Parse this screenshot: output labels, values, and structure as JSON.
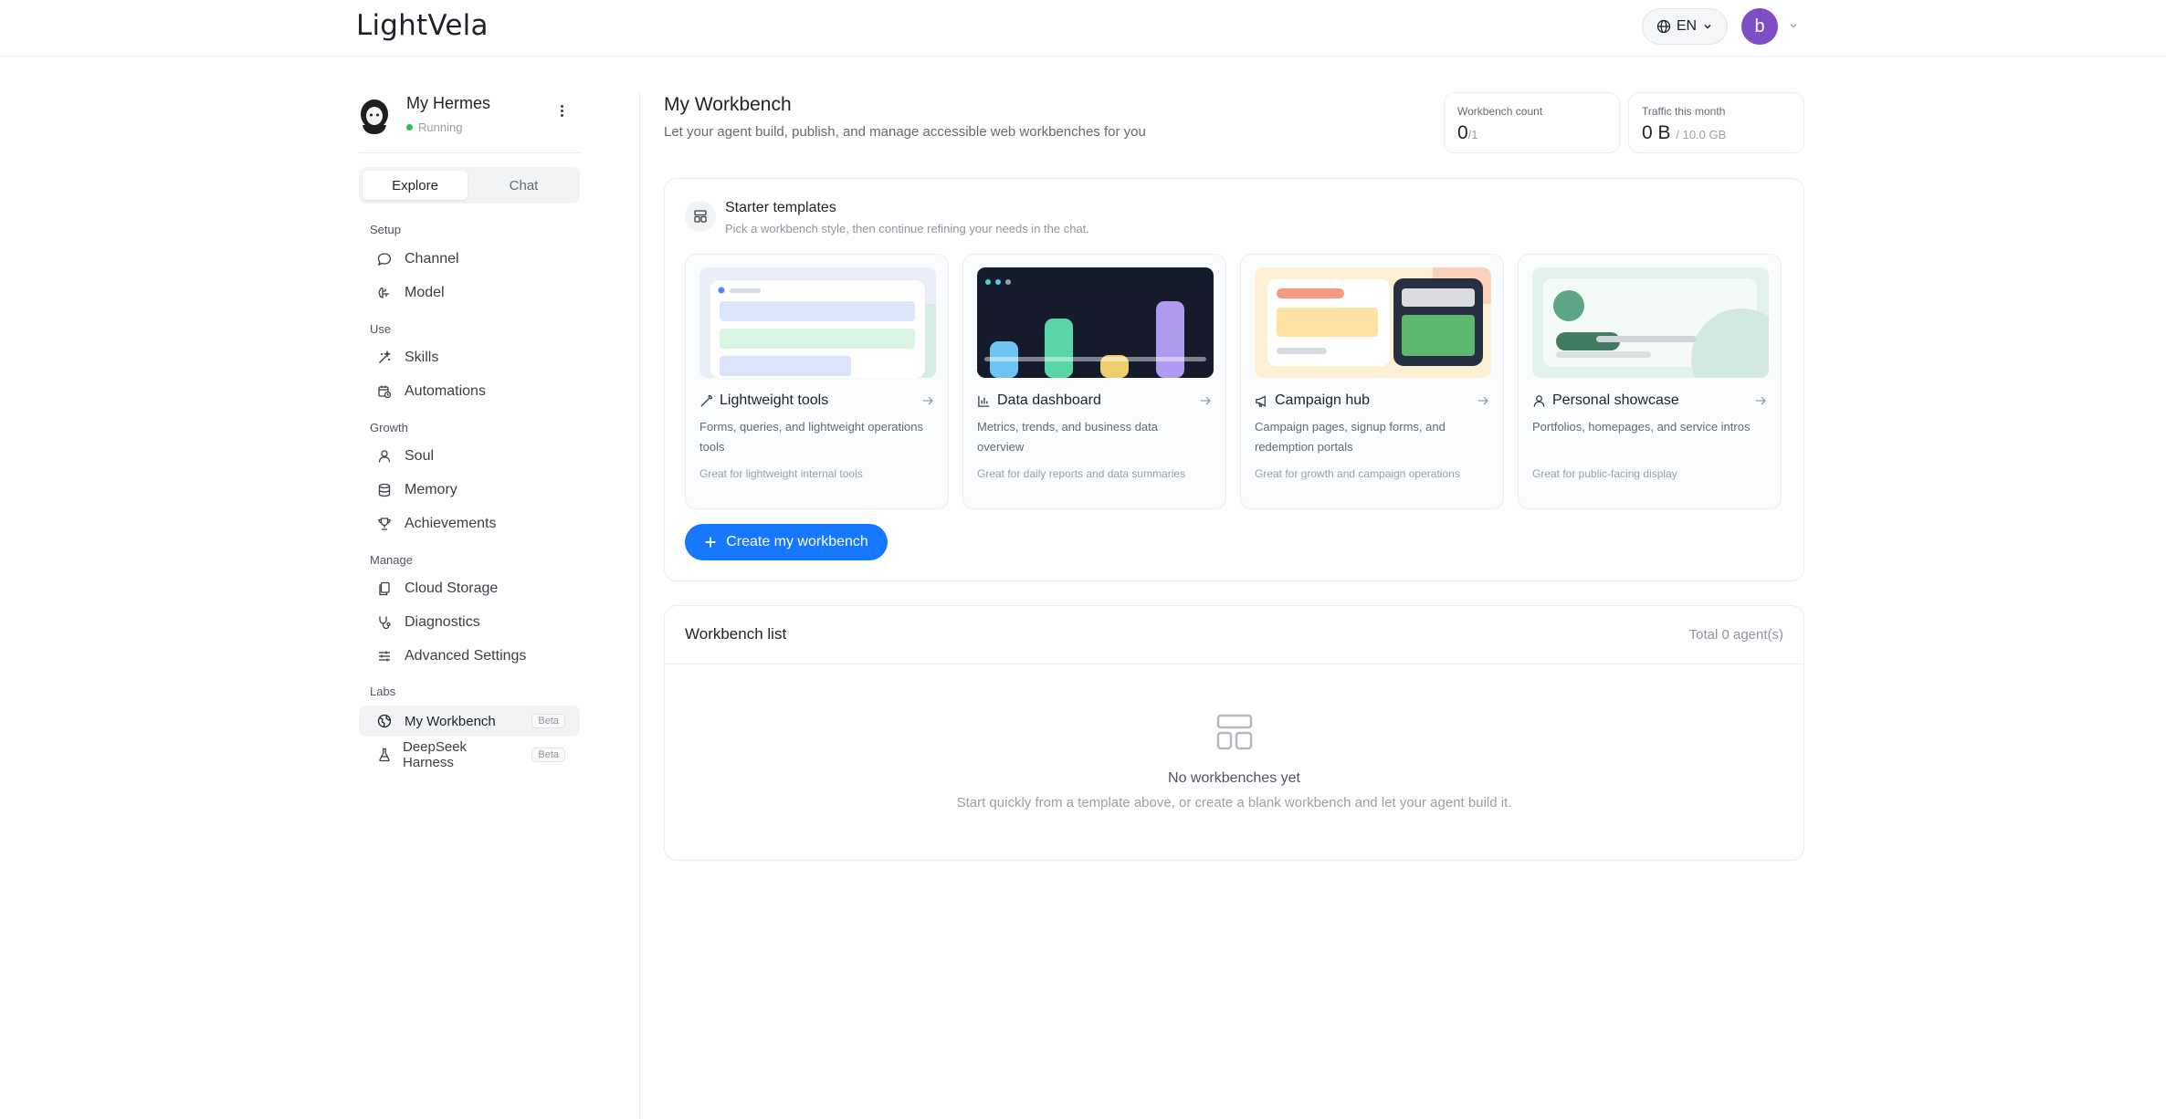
{
  "app": {
    "logo": "LightVela"
  },
  "header": {
    "language": "EN",
    "user_initial": "b"
  },
  "agent": {
    "name": "My Hermes",
    "status": "Running"
  },
  "tabs": [
    {
      "label": "Explore",
      "active": true
    },
    {
      "label": "Chat",
      "active": false
    }
  ],
  "sidebar": {
    "setup": {
      "label": "Setup",
      "items": [
        "Channel",
        "Model"
      ]
    },
    "use": {
      "label": "Use",
      "items": [
        "Skills",
        "Automations"
      ]
    },
    "growth": {
      "label": "Growth",
      "items": [
        "Soul",
        "Memory",
        "Achievements"
      ]
    },
    "manage": {
      "label": "Manage",
      "items": [
        "Cloud Storage",
        "Diagnostics",
        "Advanced Settings"
      ]
    },
    "labs": {
      "label": "Labs",
      "items": [
        {
          "label": "My Workbench",
          "badge": "Beta",
          "active": true
        },
        {
          "label": "DeepSeek Harness",
          "badge": "Beta",
          "active": false
        }
      ]
    }
  },
  "main": {
    "title": "My Workbench",
    "subtitle": "Let your agent build, publish, and manage accessible web workbenches for you",
    "stats": {
      "workbench_count": {
        "label": "Workbench count",
        "value": "0",
        "limit": "/1"
      },
      "traffic": {
        "label": "Traffic this month",
        "value": "0 B",
        "limit": "/ 10.0 GB"
      }
    },
    "templates": {
      "title": "Starter templates",
      "subtitle": "Pick a workbench style, then continue refining your needs in the chat.",
      "cards": [
        {
          "title": "Lightweight tools",
          "desc": "Forms, queries, and lightweight operations tools",
          "note": "Great for lightweight internal tools",
          "icon": "wrench-icon"
        },
        {
          "title": "Data dashboard",
          "desc": "Metrics, trends, and business data overview",
          "note": "Great for daily reports and data summaries",
          "icon": "bar-chart-icon"
        },
        {
          "title": "Campaign hub",
          "desc": "Campaign pages, signup forms, and redemption portals",
          "note": "Great for growth and campaign operations",
          "icon": "megaphone-icon"
        },
        {
          "title": "Personal showcase",
          "desc": "Portfolios, homepages, and service intros",
          "note": "Great for public-facing display",
          "icon": "user-icon"
        }
      ],
      "create_button": "Create my workbench"
    },
    "list": {
      "title": "Workbench list",
      "total": "Total 0 agent(s)",
      "empty_title": "No workbenches yet",
      "empty_sub": "Start quickly from a template above, or create a blank workbench and let your agent build it."
    }
  },
  "colors": {
    "accent": "#1677ff",
    "status_running": "#2bbd5b",
    "avatar": "#7e4ec7"
  }
}
